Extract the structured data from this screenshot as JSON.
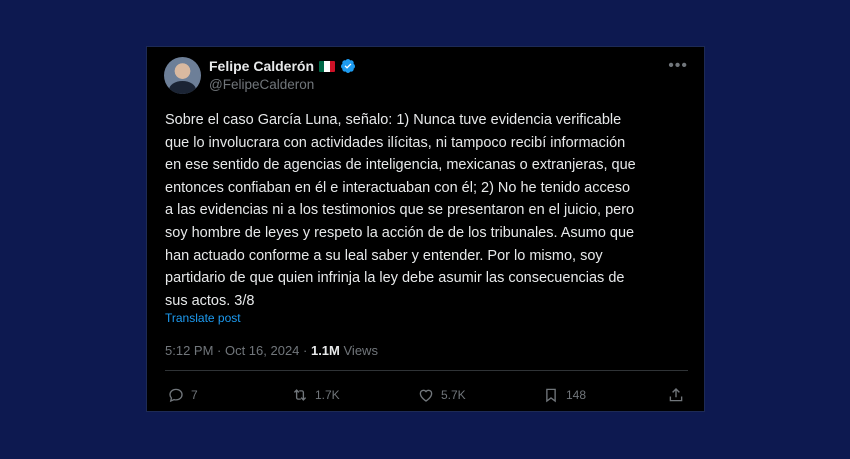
{
  "author": {
    "name": "Felipe Calderón",
    "handle": "@FelipeCalderon"
  },
  "tweet": {
    "text": "Sobre el caso García Luna, señalo: 1) Nunca tuve evidencia verificable\nque lo involucrara con actividades ilícitas, ni tampoco recibí información\nen ese sentido de agencias de inteligencia, mexicanas o extranjeras, que\nentonces confiaban en él e interactuaban con él; 2) No he tenido acceso\na las evidencias ni a los testimonios que se presentaron en el juicio, pero\nsoy hombre de leyes y respeto la acción de de los tribunales. Asumo que\nhan actuado conforme a su leal saber y entender. Por lo mismo, soy\npartidario de que quien infrinja la ley debe asumir las consecuencias de\nsus actos. 3/8",
    "translate_label": "Translate post",
    "timestamp": "5:12 PM · Oct 16, 2024",
    "separator": " · ",
    "views_count": "1.1M",
    "views_label": "Views"
  },
  "actions": {
    "replies": "7",
    "reposts": "1.7K",
    "likes": "5.7K",
    "bookmarks": "148"
  },
  "colors": {
    "background": "#0d1950",
    "card": "#000000",
    "text": "#e7e9ea",
    "muted": "#71767b",
    "link": "#1d9bf0"
  },
  "icons": [
    "more-icon",
    "verified-icon",
    "flag-icon",
    "reply-icon",
    "repost-icon",
    "like-icon",
    "bookmark-icon",
    "share-icon"
  ]
}
